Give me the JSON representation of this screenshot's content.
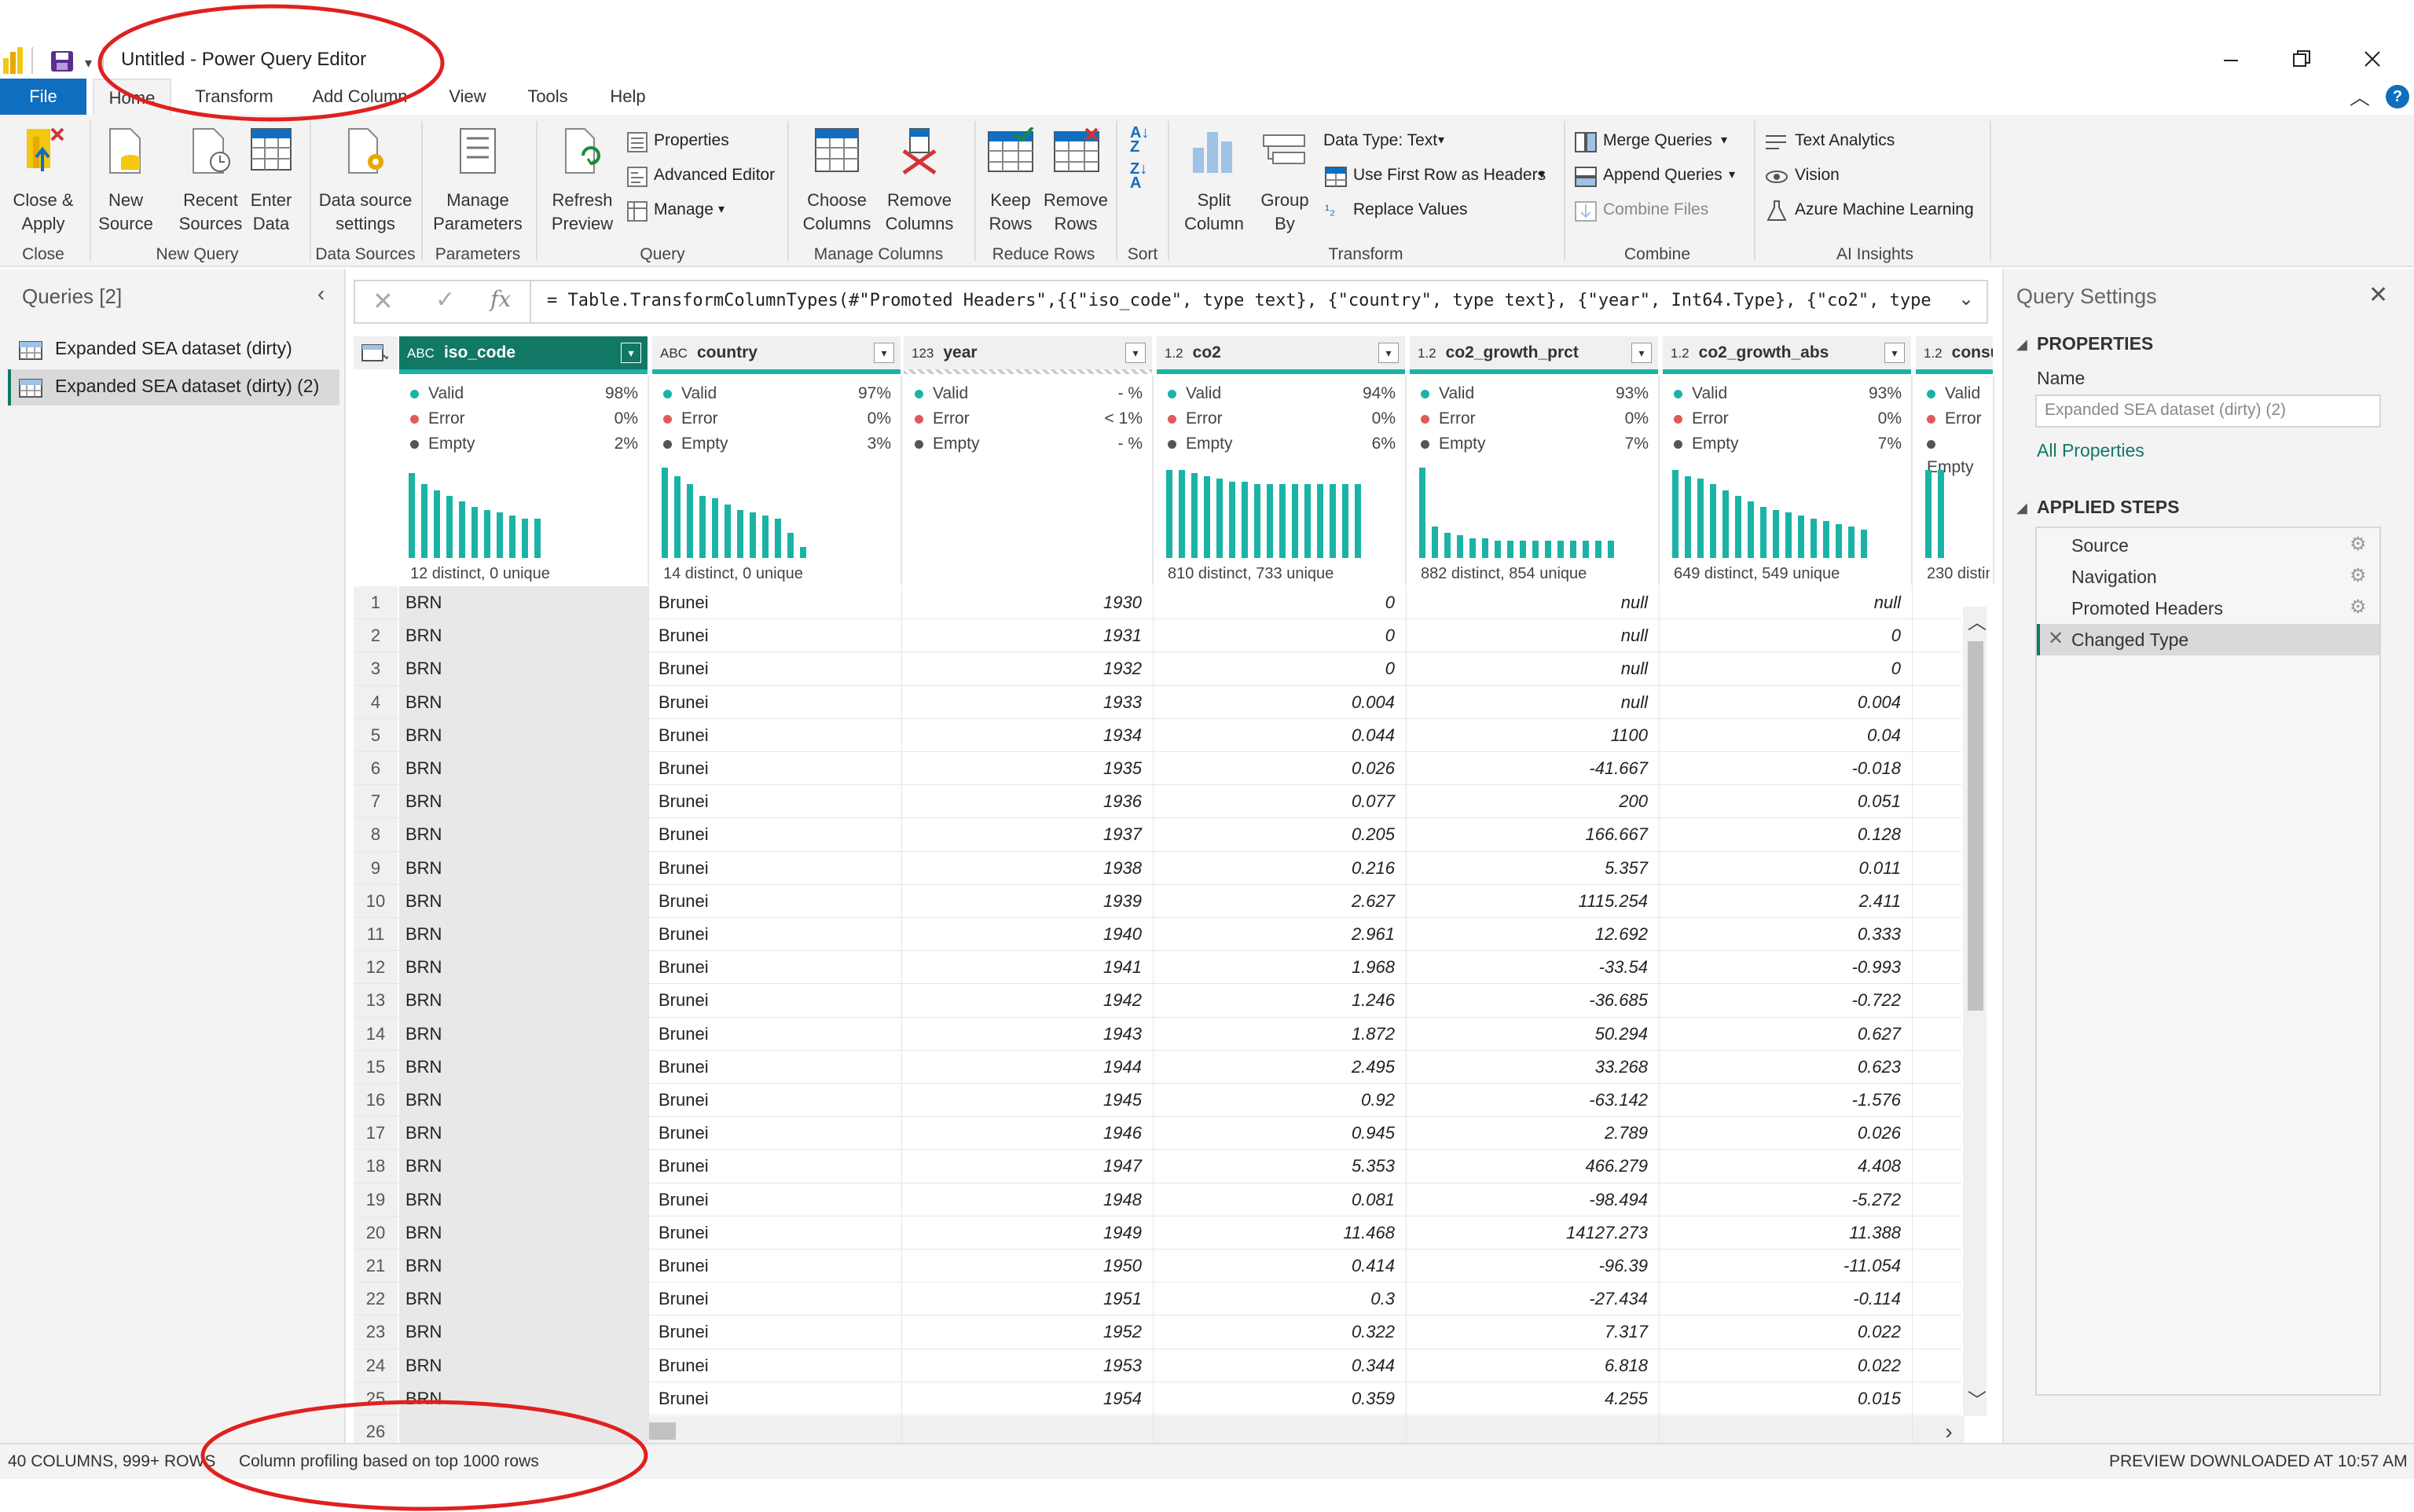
{
  "app": {
    "title": "Untitled - Power Query Editor",
    "window_controls": [
      "minimize-icon",
      "restore-icon",
      "close-icon"
    ]
  },
  "menu": {
    "file": "File",
    "tabs": [
      "Home",
      "Transform",
      "Add Column",
      "View",
      "Tools",
      "Help"
    ]
  },
  "ribbon": {
    "close_apply": [
      "Close &",
      "Apply"
    ],
    "new_source": [
      "New",
      "Source"
    ],
    "recent_sources": [
      "Recent",
      "Sources"
    ],
    "enter_data": [
      "Enter",
      "Data"
    ],
    "data_source_settings": [
      "Data source",
      "settings"
    ],
    "manage_parameters": [
      "Manage",
      "Parameters"
    ],
    "refresh_preview": [
      "Refresh",
      "Preview"
    ],
    "properties": "Properties",
    "advanced_editor": "Advanced Editor",
    "manage": "Manage",
    "choose_columns": [
      "Choose",
      "Columns"
    ],
    "remove_columns": [
      "Remove",
      "Columns"
    ],
    "keep_rows": [
      "Keep",
      "Rows"
    ],
    "remove_rows": [
      "Remove",
      "Rows"
    ],
    "split_column": [
      "Split",
      "Column"
    ],
    "group_by": [
      "Group",
      "By"
    ],
    "data_type": "Data Type: Text",
    "first_row_headers": "Use First Row as Headers",
    "replace_values": "Replace Values",
    "merge_queries": "Merge Queries",
    "append_queries": "Append Queries",
    "combine_files": "Combine Files",
    "text_analytics": "Text Analytics",
    "vision": "Vision",
    "azure_ml": "Azure Machine Learning",
    "groups": [
      "Close",
      "New Query",
      "Data Sources",
      "Parameters",
      "Query",
      "Manage Columns",
      "Reduce Rows",
      "Sort",
      "Transform",
      "Combine",
      "AI Insights"
    ]
  },
  "queries": {
    "title": "Queries [2]",
    "items": [
      "Expanded SEA dataset (dirty)",
      "Expanded SEA dataset (dirty) (2)"
    ]
  },
  "formula": "= Table.TransformColumnTypes(#\"Promoted Headers\",{{\"iso_code\", type text}, {\"country\", type text}, {\"year\", Int64.Type}, {\"co2\", type",
  "columns": [
    {
      "type": "ABC",
      "name": "iso_code",
      "valid": "98%",
      "error": "0%",
      "empty": "2%",
      "distinct": "12 distinct, 0 unique"
    },
    {
      "type": "ABC",
      "name": "country",
      "valid": "97%",
      "error": "0%",
      "empty": "3%",
      "distinct": "14 distinct, 0 unique"
    },
    {
      "type": "123",
      "name": "year",
      "valid": "- %",
      "error": "< 1%",
      "empty": "- %",
      "distinct": ""
    },
    {
      "type": "1.2",
      "name": "co2",
      "valid": "94%",
      "error": "0%",
      "empty": "6%",
      "distinct": "810 distinct, 733 unique"
    },
    {
      "type": "1.2",
      "name": "co2_growth_prct",
      "valid": "93%",
      "error": "0%",
      "empty": "7%",
      "distinct": "882 distinct, 854 unique"
    },
    {
      "type": "1.2",
      "name": "co2_growth_abs",
      "valid": "93%",
      "error": "0%",
      "empty": "7%",
      "distinct": "649 distinct, 549 unique"
    },
    {
      "type": "1.2",
      "name": "consu",
      "valid": "Valid",
      "error": "Error",
      "empty": "Empty",
      "distinct": "230 distin"
    }
  ],
  "profile_labels": {
    "valid": "Valid",
    "error": "Error",
    "empty": "Empty"
  },
  "rows": [
    [
      "1",
      "BRN",
      "Brunei",
      "1930",
      "0",
      "null",
      "null"
    ],
    [
      "2",
      "BRN",
      "Brunei",
      "1931",
      "0",
      "null",
      "0"
    ],
    [
      "3",
      "BRN",
      "Brunei",
      "1932",
      "0",
      "null",
      "0"
    ],
    [
      "4",
      "BRN",
      "Brunei",
      "1933",
      "0.004",
      "null",
      "0.004"
    ],
    [
      "5",
      "BRN",
      "Brunei",
      "1934",
      "0.044",
      "1100",
      "0.04"
    ],
    [
      "6",
      "BRN",
      "Brunei",
      "1935",
      "0.026",
      "-41.667",
      "-0.018"
    ],
    [
      "7",
      "BRN",
      "Brunei",
      "1936",
      "0.077",
      "200",
      "0.051"
    ],
    [
      "8",
      "BRN",
      "Brunei",
      "1937",
      "0.205",
      "166.667",
      "0.128"
    ],
    [
      "9",
      "BRN",
      "Brunei",
      "1938",
      "0.216",
      "5.357",
      "0.011"
    ],
    [
      "10",
      "BRN",
      "Brunei",
      "1939",
      "2.627",
      "1115.254",
      "2.411"
    ],
    [
      "11",
      "BRN",
      "Brunei",
      "1940",
      "2.961",
      "12.692",
      "0.333"
    ],
    [
      "12",
      "BRN",
      "Brunei",
      "1941",
      "1.968",
      "-33.54",
      "-0.993"
    ],
    [
      "13",
      "BRN",
      "Brunei",
      "1942",
      "1.246",
      "-36.685",
      "-0.722"
    ],
    [
      "14",
      "BRN",
      "Brunei",
      "1943",
      "1.872",
      "50.294",
      "0.627"
    ],
    [
      "15",
      "BRN",
      "Brunei",
      "1944",
      "2.495",
      "33.268",
      "0.623"
    ],
    [
      "16",
      "BRN",
      "Brunei",
      "1945",
      "0.92",
      "-63.142",
      "-1.576"
    ],
    [
      "17",
      "BRN",
      "Brunei",
      "1946",
      "0.945",
      "2.789",
      "0.026"
    ],
    [
      "18",
      "BRN",
      "Brunei",
      "1947",
      "5.353",
      "466.279",
      "4.408"
    ],
    [
      "19",
      "BRN",
      "Brunei",
      "1948",
      "0.081",
      "-98.494",
      "-5.272"
    ],
    [
      "20",
      "BRN",
      "Brunei",
      "1949",
      "11.468",
      "14127.273",
      "11.388"
    ],
    [
      "21",
      "BRN",
      "Brunei",
      "1950",
      "0.414",
      "-96.39",
      "-11.054"
    ],
    [
      "22",
      "BRN",
      "Brunei",
      "1951",
      "0.3",
      "-27.434",
      "-0.114"
    ],
    [
      "23",
      "BRN",
      "Brunei",
      "1952",
      "0.322",
      "7.317",
      "0.022"
    ],
    [
      "24",
      "BRN",
      "Brunei",
      "1953",
      "0.344",
      "6.818",
      "0.022"
    ],
    [
      "25",
      "BRN",
      "Brunei",
      "1954",
      "0.359",
      "4.255",
      "0.015"
    ],
    [
      "26",
      "",
      "",
      "",
      "",
      "",
      ""
    ]
  ],
  "settings": {
    "title": "Query Settings",
    "properties_header": "PROPERTIES",
    "name_label": "Name",
    "name_value": "Expanded SEA dataset (dirty) (2)",
    "all_properties": "All Properties",
    "applied_steps_header": "APPLIED STEPS",
    "steps": [
      "Source",
      "Navigation",
      "Promoted Headers",
      "Changed Type"
    ]
  },
  "status": {
    "columns": "40 COLUMNS, 999+ ROWS",
    "profiling": "Column profiling based on top 1000 rows",
    "preview": "PREVIEW DOWNLOADED AT 10:57 AM"
  },
  "colors": {
    "accent": "#117865",
    "bars": "#1ab3a6",
    "file_tab": "#106ebe",
    "annotation": "#e02020"
  }
}
